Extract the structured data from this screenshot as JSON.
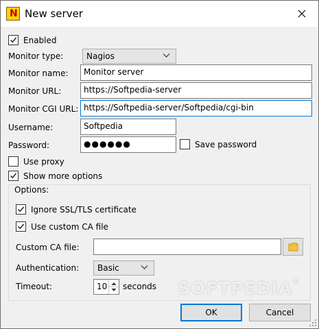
{
  "window": {
    "title": "New server"
  },
  "enabled": {
    "label": "Enabled",
    "checked": true
  },
  "monitor_type": {
    "label": "Monitor type:",
    "value": "Nagios"
  },
  "monitor_name": {
    "label": "Monitor name:",
    "value": "Monitor server"
  },
  "monitor_url": {
    "label": "Monitor URL:",
    "value": "https://Softpedia-server"
  },
  "monitor_cgi_url": {
    "label": "Monitor CGI URL:",
    "value": "https://Softpedia-server/Softpedia/cgi-bin"
  },
  "username": {
    "label": "Username:",
    "value": "Softpedia"
  },
  "password": {
    "label": "Password:",
    "value": "●●●●●●"
  },
  "save_password": {
    "label": "Save password",
    "checked": false
  },
  "use_proxy": {
    "label": "Use proxy",
    "checked": false
  },
  "show_more_options": {
    "label": "Show more options",
    "checked": true
  },
  "options": {
    "group_label": "Options:",
    "ignore_ssl": {
      "label": "Ignore SSL/TLS certificate",
      "checked": true
    },
    "use_custom_ca": {
      "label": "Use custom CA file",
      "checked": true
    },
    "custom_ca_file": {
      "label": "Custom CA file:",
      "value": ""
    },
    "authentication": {
      "label": "Authentication:",
      "value": "Basic"
    },
    "timeout": {
      "label": "Timeout:",
      "value": "10",
      "unit": "seconds"
    }
  },
  "buttons": {
    "ok": "OK",
    "cancel": "Cancel"
  },
  "watermark": "SOFTPEDIA",
  "icons": {
    "app": "nagstamon-app-icon",
    "close": "close-icon",
    "checkmark": "checkmark-icon",
    "chevron": "chevron-down-icon",
    "folder": "folder-icon",
    "spin": "spin-arrows-icon",
    "grip": "resize-grip-icon"
  },
  "colors": {
    "focus": "#0078d7",
    "titlebar": "#ffffff",
    "dialog": "#f0f0f0"
  }
}
